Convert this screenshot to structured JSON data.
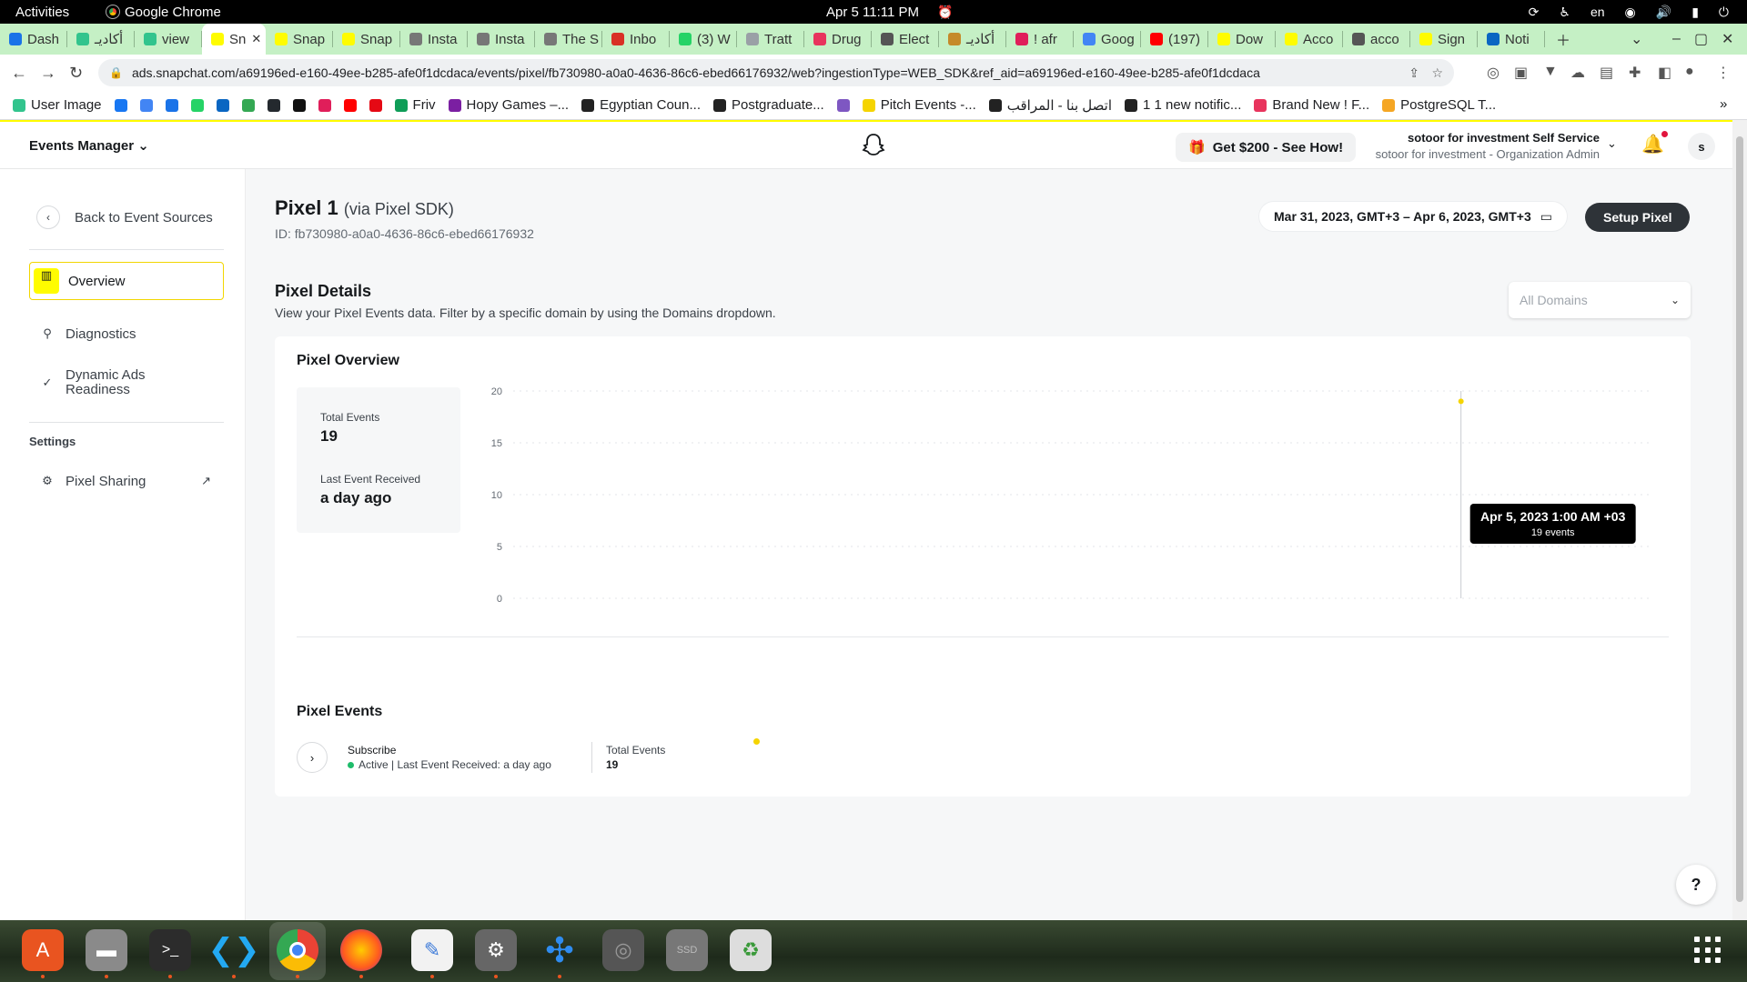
{
  "os": {
    "activities": "Activities",
    "app_name": "Google Chrome",
    "clock": "Apr 5  11:11 PM",
    "language": "en"
  },
  "browser": {
    "tabs": [
      {
        "label": "Dash",
        "color": "#1a73e8"
      },
      {
        "label": "أكاديـ",
        "color": "#32c48d"
      },
      {
        "label": "view",
        "color": "#32c48d"
      },
      {
        "label": "Sn",
        "color": "#fffc00",
        "active": true
      },
      {
        "label": "Snap",
        "color": "#fffc00"
      },
      {
        "label": "Snap",
        "color": "#fffc00"
      },
      {
        "label": "Insta",
        "color": "#777777"
      },
      {
        "label": "Insta",
        "color": "#777777"
      },
      {
        "label": "The S",
        "color": "#777777"
      },
      {
        "label": "Inbo",
        "color": "#d93025"
      },
      {
        "label": "(3) W",
        "color": "#25d366"
      },
      {
        "label": "Tratt",
        "color": "#9aa0a6"
      },
      {
        "label": "Drug",
        "color": "#e8345d"
      },
      {
        "label": "Elect",
        "color": "#555555"
      },
      {
        "label": "أكاديـ",
        "color": "#c58a2a"
      },
      {
        "label": "! afr",
        "color": "#e01e5a"
      },
      {
        "label": "Goog",
        "color": "#4285f4"
      },
      {
        "label": "(197)",
        "color": "#ff0000"
      },
      {
        "label": "Dow",
        "color": "#fffc00"
      },
      {
        "label": "Acco",
        "color": "#fffc00"
      },
      {
        "label": "acco",
        "color": "#555555"
      },
      {
        "label": "Sign",
        "color": "#fffc00"
      },
      {
        "label": "Noti",
        "color": "#0a66c2"
      }
    ],
    "url": "ads.snapchat.com/a69196ed-e160-49ee-b285-afe0f1dcdaca/events/pixel/fb730980-a0a0-4636-86c6-ebed66176932/web?ingestionType=WEB_SDK&ref_aid=a69196ed-e160-49ee-b285-afe0f1dcdaca",
    "bookmarks": [
      {
        "label": "User Image",
        "color": "#32c48d"
      },
      {
        "label": "",
        "color": "#1877f2"
      },
      {
        "label": "",
        "color": "#4285f4"
      },
      {
        "label": "",
        "color": "#1a73e8"
      },
      {
        "label": "",
        "color": "#25d366"
      },
      {
        "label": "",
        "color": "#0a66c2"
      },
      {
        "label": "",
        "color": "#34a853"
      },
      {
        "label": "",
        "color": "#24292e"
      },
      {
        "label": "",
        "color": "#111111"
      },
      {
        "label": "",
        "color": "#e01e5a"
      },
      {
        "label": "",
        "color": "#ff0000"
      },
      {
        "label": "",
        "color": "#e50914"
      },
      {
        "label": "Friv",
        "color": "#0f9d58"
      },
      {
        "label": "Hopy Games –...",
        "color": "#7b1fa2"
      },
      {
        "label": "Egyptian Coun...",
        "color": "#222222"
      },
      {
        "label": "Postgraduate...",
        "color": "#222222"
      },
      {
        "label": "",
        "color": "#7e57c2"
      },
      {
        "label": "Pitch Events -...",
        "color": "#f5d400"
      },
      {
        "label": "اتصل بنا - المراقب",
        "color": "#222222"
      },
      {
        "label": "1 1 new notific...",
        "color": "#222222"
      },
      {
        "label": "Brand New ! F...",
        "color": "#e8345d"
      },
      {
        "label": "PostgreSQL T...",
        "color": "#f5a623"
      }
    ]
  },
  "app": {
    "product": "Events Manager",
    "promo": "Get $200 - See How!",
    "org_name": "sotoor for investment Self Service",
    "org_role": "sotoor for investment - Organization Admin",
    "avatar_initial": "s"
  },
  "sidebar": {
    "back": "Back to Event Sources",
    "items": [
      {
        "label": "Overview",
        "icon": "bar-chart-icon",
        "active": true
      },
      {
        "label": "Diagnostics",
        "icon": "search-icon"
      },
      {
        "label": "Dynamic Ads Readiness",
        "icon": "check-icon"
      }
    ],
    "settings_heading": "Settings",
    "settings_items": [
      {
        "label": "Pixel Sharing",
        "icon": "gear-icon"
      }
    ]
  },
  "page": {
    "title": "Pixel 1",
    "title_via": "(via Pixel SDK)",
    "id_line": "ID: fb730980-a0a0-4636-86c6-ebed66176932",
    "date_range": "Mar 31, 2023, GMT+3 – Apr 6, 2023, GMT+3",
    "setup_button": "Setup Pixel",
    "section_title": "Pixel Details",
    "section_sub": "View your Pixel Events data. Filter by a specific domain by using the Domains dropdown.",
    "domains_placeholder": "All Domains"
  },
  "overview": {
    "title": "Pixel Overview",
    "total_label": "Total Events",
    "total_value": "19",
    "last_label": "Last Event Received",
    "last_value": "a day ago"
  },
  "chart_data": {
    "type": "line",
    "title": "",
    "xlabel": "",
    "ylabel": "",
    "ylim": [
      0,
      20
    ],
    "yticks": [
      0,
      5,
      10,
      15,
      20
    ],
    "x_range_hours": [
      0,
      144
    ],
    "points": [
      {
        "x": "Apr 5, 2023 1:00 AM +03",
        "hour": 120,
        "y": 19
      }
    ],
    "tooltip": {
      "title": "Apr 5, 2023 1:00 AM +03",
      "value": "19 events"
    },
    "grid": true,
    "accent": "#f5d400"
  },
  "events": {
    "title": "Pixel Events",
    "rows": [
      {
        "name": "Subscribe",
        "status": "Active | Last Event Received: a day ago",
        "total_label": "Total Events",
        "total": "19"
      }
    ]
  }
}
